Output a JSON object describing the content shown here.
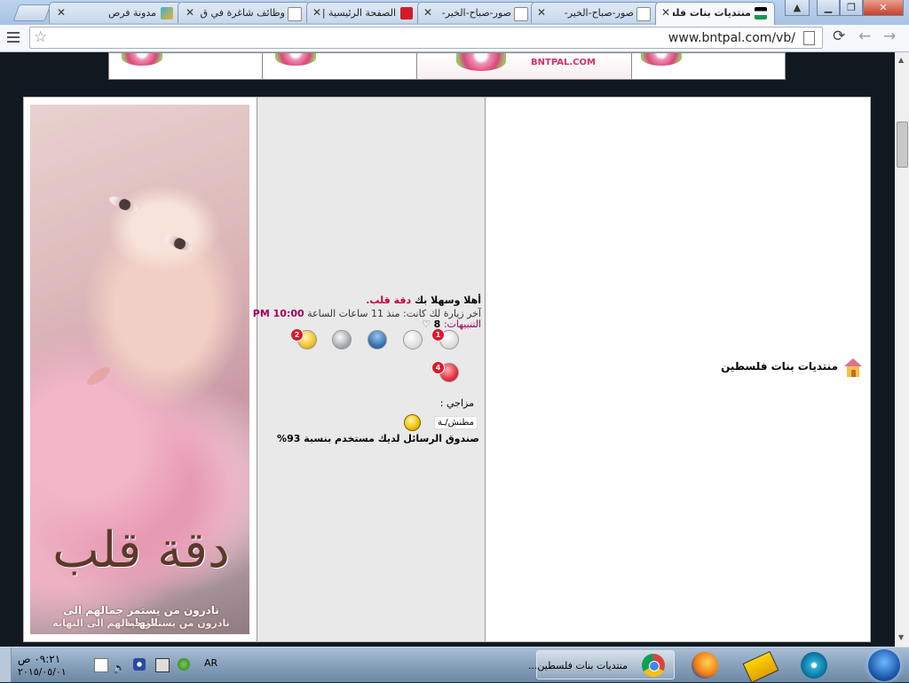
{
  "browser": {
    "tabs": [
      {
        "title": "منتديات بنات فلسطين",
        "active": true
      },
      {
        "title": "صور-صباح-الخير-",
        "active": false
      },
      {
        "title": "صور-صباح-الخير-",
        "active": false
      },
      {
        "title": "الصفحة الرئيسية | ت",
        "active": false
      },
      {
        "title": "وظائف شاغرة في ق",
        "active": false
      },
      {
        "title": "مدونة فرص",
        "active": false
      }
    ],
    "url": "www.bntpal.com/vb/",
    "close_glyph": "✕"
  },
  "banner": {
    "brand_text": "BNTPAL.COM"
  },
  "user_box": {
    "welcome_prefix": "أهلا وسهلا بك",
    "username": "دقة قلب.",
    "last_visit_text": "آخر زيارة لك كانت: منذ 11 ساعات الساعة",
    "last_visit_time": "10:00 PM",
    "alerts_label": "التنبيهات:",
    "alerts_count": "8",
    "alerts_icon": "heart-outline-icon",
    "icons": [
      {
        "name": "favorites-star-icon",
        "badge": "2"
      },
      {
        "name": "chat-bubbles-icon",
        "badge": ""
      },
      {
        "name": "user-profile-icon",
        "badge": ""
      },
      {
        "name": "mail-envelope-icon",
        "badge": ""
      },
      {
        "name": "private-messages-icon",
        "badge": "1"
      },
      {
        "name": "heart-likes-icon",
        "badge": "4"
      }
    ],
    "mood_label": "مزاجي :",
    "mood_value": "مطنش/ـة",
    "inbox_usage": "صندوق الرسائل لديك مستخدم بنسبة 93%"
  },
  "avatar": {
    "signature": "دقة قلب",
    "slogan_line1": "نادرون من يستمر جمالهم الى النهاية",
    "slogan_line2": "نادرون من يستمر جمالهم الى النهاية"
  },
  "forum": {
    "name": "منتديات بنات فلسطين",
    "logo_icon": "house-icon"
  },
  "taskbar": {
    "time": "٠٩:٢١ ص",
    "date": "٢٠١٥/٠٥/٠١",
    "language": "AR",
    "chrome_task_label": "منتديات بنات فلسطين...",
    "pinned": [
      "chrome-icon",
      "firefox-icon",
      "taxi-game-icon",
      "media-player-icon"
    ]
  },
  "colors": {
    "username_red": "#c0003a",
    "time_purple": "#a0005a",
    "badge_red": "#e0182a",
    "tabstrip_blue": "#a8c2e3"
  }
}
